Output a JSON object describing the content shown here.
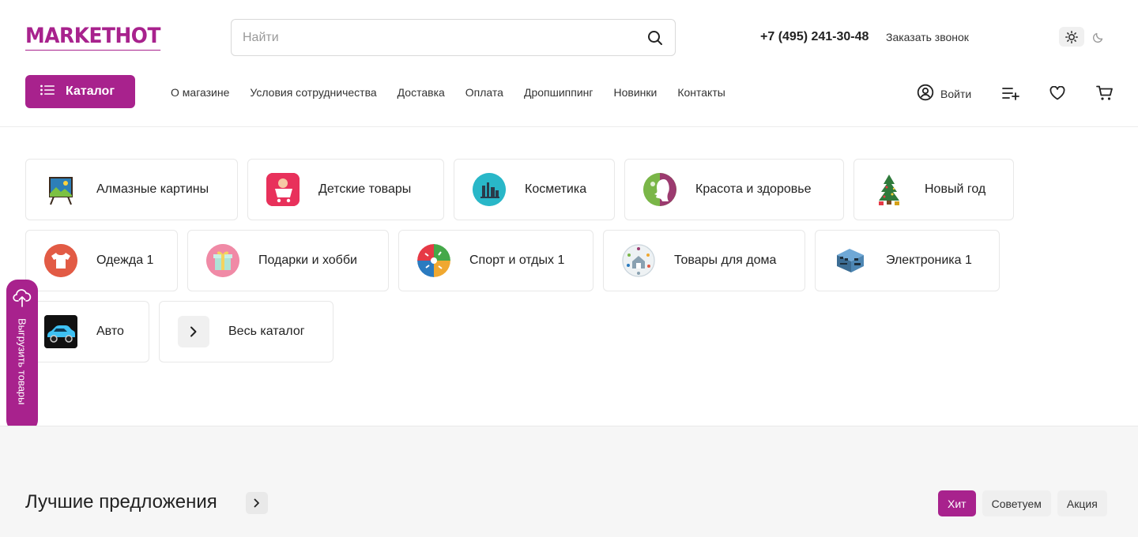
{
  "brand": {
    "logo": "MARKETHOT",
    "accent_color": "#a8228d"
  },
  "search": {
    "placeholder": "Найти",
    "icon": "search-icon"
  },
  "contacts": {
    "phone": "+7 (495) 241-30-48",
    "callback": "Заказать звонок"
  },
  "theme": {
    "light_icon": "sun-icon",
    "dark_icon": "moon-icon"
  },
  "catalog_button": {
    "label": "Каталог",
    "icon": "list-icon"
  },
  "nav": [
    "О магазине",
    "Условия сотрудничества",
    "Доставка",
    "Оплата",
    "Дропшиппинг",
    "Новинки",
    "Контакты"
  ],
  "user": {
    "login": "Войти",
    "icons": [
      "compare-list-icon",
      "heart-icon",
      "cart-icon"
    ]
  },
  "categories": [
    {
      "label": "Алмазные картины",
      "icon": "easel-painting-icon"
    },
    {
      "label": "Детские товары",
      "icon": "kids-cart-icon"
    },
    {
      "label": "Косметика",
      "icon": "cosmetics-icon"
    },
    {
      "label": "Красота и здоровье",
      "icon": "beauty-face-icon"
    },
    {
      "label": "Новый год",
      "icon": "christmas-tree-icon"
    },
    {
      "label": "Одежда 1",
      "icon": "tshirt-icon"
    },
    {
      "label": "Подарки и хобби",
      "icon": "gift-icon"
    },
    {
      "label": "Спорт и отдых 1",
      "icon": "sport-icon"
    },
    {
      "label": "Товары для дома",
      "icon": "home-goods-icon"
    },
    {
      "label": "Электроника 1",
      "icon": "electronics-icon"
    },
    {
      "label": "Авто",
      "icon": "car-icon"
    },
    {
      "label": "Весь каталог",
      "icon": "chevron-right-icon"
    }
  ],
  "side_tab": {
    "label": "Выгрузить товары",
    "icon": "cloud-upload-icon"
  },
  "best_offers": {
    "title": "Лучшие предложения",
    "filters": [
      {
        "label": "Хит",
        "active": true
      },
      {
        "label": "Советуем",
        "active": false
      },
      {
        "label": "Акция",
        "active": false
      }
    ]
  }
}
